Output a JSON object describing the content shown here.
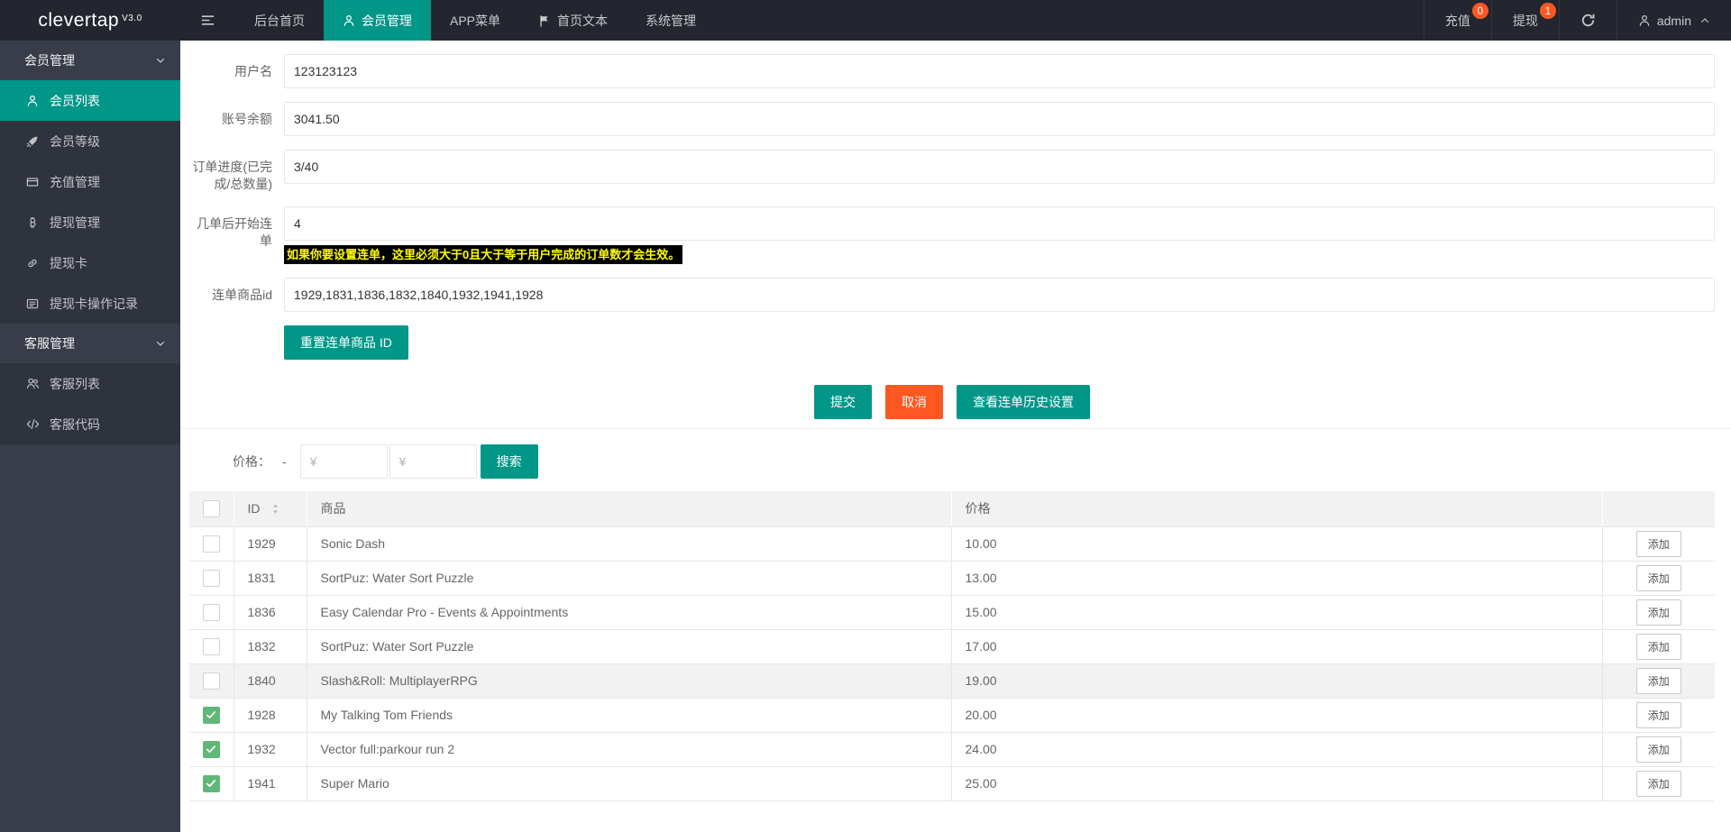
{
  "topbar": {
    "logo": "clevertap",
    "version": "V3.0",
    "menu_icon": "menu",
    "nav": [
      {
        "key": "dashboard",
        "label": "后台首页"
      },
      {
        "key": "member-admin",
        "label": "会员管理",
        "icon": "user",
        "active": true
      },
      {
        "key": "app-menu",
        "label": "APP菜单"
      },
      {
        "key": "home-text",
        "label": "首页文本",
        "icon": "flag"
      },
      {
        "key": "system-admin",
        "label": "系统管理"
      }
    ],
    "right": [
      {
        "key": "recharge",
        "label": "充值",
        "badge": "0"
      },
      {
        "key": "withdraw",
        "label": "提现",
        "badge": "1"
      },
      {
        "key": "refresh",
        "icon": "refresh"
      },
      {
        "key": "admin",
        "label": "admin",
        "icon": "user",
        "chevron": "up"
      }
    ]
  },
  "sidebar": {
    "groups": [
      {
        "key": "member-admin",
        "label": "会员管理",
        "expanded": true,
        "items": [
          {
            "key": "member-list",
            "label": "会员列表",
            "icon": "user",
            "active": true
          },
          {
            "key": "member-level",
            "label": "会员等级",
            "icon": "rocket"
          },
          {
            "key": "recharge-admin",
            "label": "充值管理",
            "icon": "card"
          },
          {
            "key": "withdraw-admin",
            "label": "提现管理",
            "icon": "bitcoin"
          },
          {
            "key": "withdraw-card",
            "label": "提现卡",
            "icon": "link"
          },
          {
            "key": "withdraw-card-log",
            "label": "提现卡操作记录",
            "icon": "list"
          }
        ]
      },
      {
        "key": "service-admin",
        "label": "客服管理",
        "expanded": true,
        "items": [
          {
            "key": "service-list",
            "label": "客服列表",
            "icon": "users"
          },
          {
            "key": "service-code",
            "label": "客服代码",
            "icon": "code"
          }
        ]
      }
    ]
  },
  "form": {
    "fields": [
      {
        "label": "用户名",
        "value": "123123123"
      },
      {
        "label": "账号余额",
        "value": "3041.50"
      },
      {
        "label": "订单进度(已完成/总数量)",
        "value": "3/40"
      },
      {
        "label": "几单后开始连单",
        "value": "4",
        "help": "如果你要设置连单，这里必须大于0且大于等于用户完成的订单数才会生效。"
      },
      {
        "label": "连单商品id",
        "value": "1929,1831,1836,1832,1840,1932,1941,1928"
      }
    ],
    "reset_button": "重置连单商品 ID"
  },
  "actions": {
    "submit": "提交",
    "cancel": "取消",
    "history": "查看连单历史设置"
  },
  "filter": {
    "label": "价格：",
    "dash": "-",
    "min_placeholder": "¥",
    "max_placeholder": "¥",
    "search": "搜索"
  },
  "table": {
    "headers": {
      "id": "ID",
      "product": "商品",
      "price": "价格"
    },
    "action_label": "添加",
    "rows": [
      {
        "id": "1929",
        "product": "Sonic Dash",
        "price": "10.00",
        "checked": false
      },
      {
        "id": "1831",
        "product": "SortPuz: Water Sort Puzzle",
        "price": "13.00",
        "checked": false
      },
      {
        "id": "1836",
        "product": "Easy Calendar Pro - Events & Appointments",
        "price": "15.00",
        "checked": false
      },
      {
        "id": "1832",
        "product": "SortPuz: Water Sort Puzzle",
        "price": "17.00",
        "checked": false
      },
      {
        "id": "1840",
        "product": "Slash&Roll: MultiplayerRPG",
        "price": "19.00",
        "checked": false,
        "hover": true
      },
      {
        "id": "1928",
        "product": "My Talking Tom Friends",
        "price": "20.00",
        "checked": true
      },
      {
        "id": "1932",
        "product": "Vector full:parkour run 2",
        "price": "24.00",
        "checked": true
      },
      {
        "id": "1941",
        "product": "Super Mario",
        "price": "25.00",
        "checked": true
      }
    ]
  },
  "colors": {
    "topbar_bg": "#23262E",
    "sidebar_bg": "#393D49",
    "sidebar_child_bg": "#2F333E",
    "accent": "#009688",
    "danger": "#FF5722",
    "badge": "#FF5722",
    "checkbox_checked": "#5FB878",
    "warning_bg": "#000000",
    "warning_text": "#FFFF00"
  }
}
